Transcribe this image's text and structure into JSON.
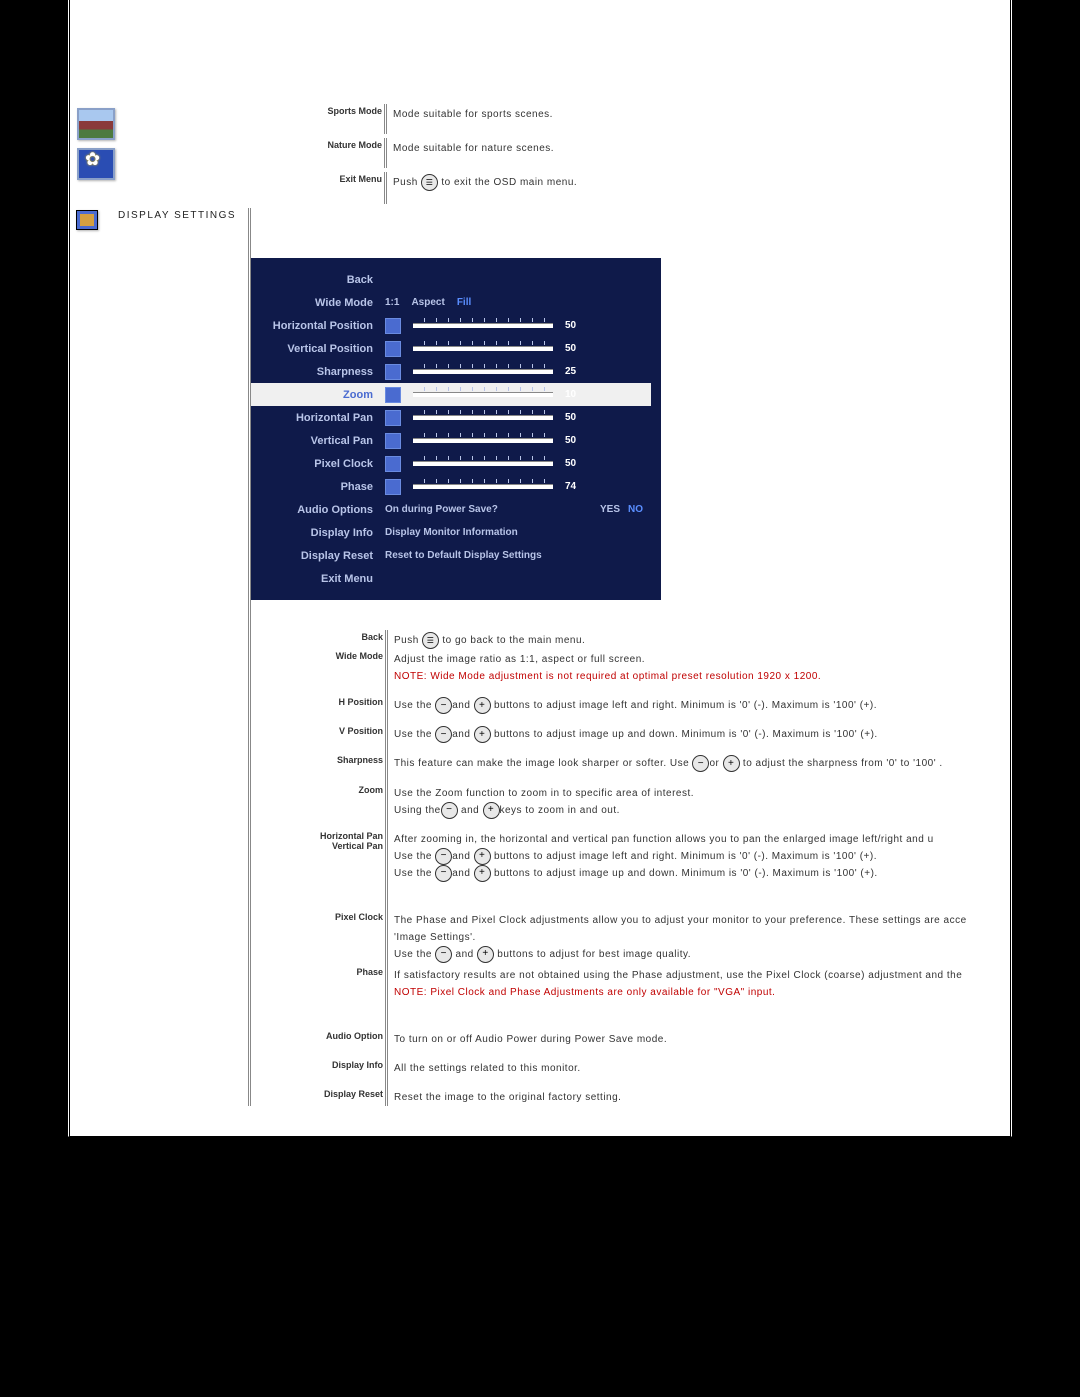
{
  "top_rows": [
    {
      "label": "Sports Mode",
      "desc": "Mode suitable for sports scenes."
    },
    {
      "label": "Nature Mode",
      "desc": "Mode suitable for nature scenes."
    },
    {
      "label": "Exit Menu",
      "desc_before": "Push ",
      "icon": "menu",
      "desc_after": " to exit the OSD main menu."
    }
  ],
  "display_settings": {
    "title": "DISPLAY SETTINGS",
    "osd": {
      "rows": [
        {
          "label": "Back"
        },
        {
          "label": "Wide Mode",
          "opts": [
            "1:1",
            "Aspect",
            "Fill"
          ],
          "hl": 2
        },
        {
          "label": "Horizontal Position",
          "slider": true,
          "num": "50"
        },
        {
          "label": "Vertical Position",
          "slider": true,
          "num": "50"
        },
        {
          "label": "Sharpness",
          "slider": true,
          "num": "25"
        },
        {
          "label": "Zoom",
          "slider": true,
          "num": "10",
          "selected": true
        },
        {
          "label": "Horizontal Pan",
          "slider": true,
          "num": "50"
        },
        {
          "label": "Vertical Pan",
          "slider": true,
          "num": "50"
        },
        {
          "label": "Pixel Clock",
          "slider": true,
          "num": "50"
        },
        {
          "label": "Phase",
          "slider": true,
          "num": "74"
        },
        {
          "label": "Audio Options",
          "text": "On during Power Save?",
          "opts2": [
            "YES",
            "NO"
          ],
          "hl2": 1
        },
        {
          "label": "Display Info",
          "text": "Display Monitor Information"
        },
        {
          "label": "Display Reset",
          "text": "Reset to Default Display Settings"
        },
        {
          "label": "Exit Menu"
        }
      ]
    },
    "desc_rows": [
      {
        "label": "Back",
        "lines": [
          {
            "t": "Push ",
            "icon": "menu",
            "t2": " to go back to the main menu."
          }
        ]
      },
      {
        "label": "Wide Mode",
        "lines": [
          {
            "t": "Adjust the image ratio as 1:1, aspect or full screen."
          },
          {
            "note": true,
            "t": "NOTE: Wide Mode adjustment is not required at optimal preset resolution 1920 x 1200."
          }
        ]
      },
      {
        "label": "H Position",
        "lines": [
          {
            "t": "Use the ",
            "icon": "minus",
            "t2": "and ",
            "icon2": "plus",
            "t3": " buttons to adjust image left and right. Minimum is '0' (-). Maximum is '100' (+)."
          }
        ]
      },
      {
        "label": "V Position",
        "lines": [
          {
            "t": "Use the ",
            "icon": "minus",
            "t2": "and ",
            "icon2": "plus",
            "t3": " buttons to adjust image up and down. Minimum is '0' (-). Maximum is '100' (+)."
          }
        ]
      },
      {
        "label": "Sharpness",
        "lines": [
          {
            "t": "This feature can make the image look sharper or softer. Use ",
            "icon": "minus",
            "t2": "or ",
            "icon2": "plus",
            "t3": " to adjust the sharpness from '0' to '100' ."
          }
        ]
      },
      {
        "label": "Zoom",
        "lines": [
          {
            "t": "Use the Zoom function to zoom in to specific area of interest."
          },
          {
            "t": "Using the",
            "icon": "minus",
            "t2": " and ",
            "icon2": "plus",
            "t3": "keys to zoom in and out."
          }
        ]
      },
      {
        "label": "Horizontal Pan\nVertical  Pan",
        "lines": [
          {
            "t": "After zooming in, the horizontal and vertical pan function allows you to pan the enlarged image left/right and u"
          },
          {
            "t": "Use the ",
            "icon": "minus",
            "t2": "and ",
            "icon2": "plus",
            "t3": " buttons to adjust image left and right. Minimum is '0' (-). Maximum is '100' (+)."
          },
          {
            "t": "Use the ",
            "icon": "minus",
            "t2": "and ",
            "icon2": "plus",
            "t3": " buttons to adjust image up and down. Minimum is '0' (-). Maximum is '100' (+)."
          }
        ]
      },
      {
        "label": "Pixel Clock",
        "lines": [
          {
            "t": "The Phase and Pixel Clock adjustments allow you to adjust your monitor to your preference. These settings are acce"
          },
          {
            "t": "'Image Settings'."
          },
          {
            "t": "Use the ",
            "icon": "minus",
            "t2": " and ",
            "icon2": "plus",
            "t3": " buttons to adjust for best image quality."
          }
        ]
      },
      {
        "label": "Phase",
        "lines": [
          {
            "t": "If satisfactory results are not obtained using the Phase adjustment, use the Pixel Clock (coarse) adjustment and the"
          },
          {
            "note": true,
            "t": "NOTE: Pixel Clock and Phase Adjustments are only available for \"VGA\" input."
          }
        ]
      },
      {
        "label": "Audio Option",
        "lines": [
          {
            "t": "To turn on or off Audio Power during Power Save mode."
          }
        ]
      },
      {
        "label": "Display Info",
        "lines": [
          {
            "t": "All the settings related to this monitor."
          }
        ]
      },
      {
        "label": "Display Reset",
        "lines": [
          {
            "t": "Reset the image to the original factory setting."
          }
        ]
      }
    ]
  }
}
